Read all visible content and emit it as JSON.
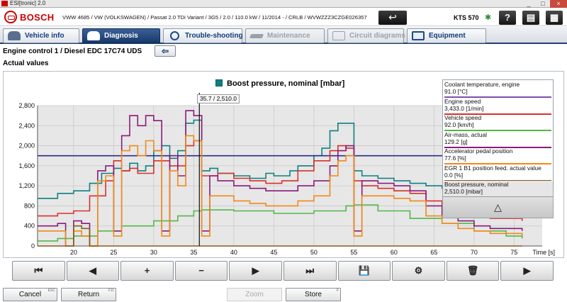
{
  "window": {
    "title": "ESI[tronic] 2.0",
    "minimize": "_",
    "maximize": "□",
    "close": "×"
  },
  "header": {
    "brand": "BOSCH",
    "vehicle": "VWW 4685 / VW (VOLKSWAGEN) / Passat 2.0 TDi Variant / 3G5 / 2.0 / 110.0 kW / 11/2014 - / CRLB / WVWZZZ3CZGE026357",
    "back_icon": "↩",
    "device": "KTS 570",
    "bluetooth_icon": "✱",
    "help_icon": "?",
    "print_icon": "▤",
    "menu_icon": "▦"
  },
  "tabs": [
    {
      "label": "Vehicle info",
      "state": "normal"
    },
    {
      "label": "Diagnosis",
      "state": "active"
    },
    {
      "label": "Trouble-shooting",
      "state": "normal"
    },
    {
      "label": "Maintenance",
      "state": "disabled"
    },
    {
      "label": "Circuit diagrams",
      "state": "disabled"
    },
    {
      "label": "Equipment",
      "state": "normal"
    }
  ],
  "ecu": {
    "title": "Engine control 1 / Diesel EDC 17C74 UDS",
    "back_icon": "⇦"
  },
  "subtitle": "Actual values",
  "cursor_readout": "35.7 / 2,510.0",
  "legend": [
    {
      "name": "Coolant temperature, engine",
      "value": "91.0 [°C]",
      "color": "#7f4fa8"
    },
    {
      "name": "Engine speed",
      "value": "3,433.0 [1/min]",
      "color": "#d9302a"
    },
    {
      "name": "Vehicle speed",
      "value": "92.0 [km/h]",
      "color": "#52b848"
    },
    {
      "name": "Air-mass, actual",
      "value": "129.2 [g]",
      "color": "#8a1a7a"
    },
    {
      "name": "Accelerator pedal position",
      "value": "77.6 [%]",
      "color": "#f08a18"
    },
    {
      "name": "EGR 1 B1 position feed. actual value",
      "value": "0.0 [%]",
      "color": "#8a5a1a"
    },
    {
      "name": "Boost pressure, nominal",
      "value": "2,510.0 [mbar]",
      "color": "#0f8080"
    }
  ],
  "legend_scroll_icon": "△",
  "toolbar": [
    {
      "icon": "first-icon",
      "glyph": "⏮"
    },
    {
      "icon": "prev-icon",
      "glyph": "◀"
    },
    {
      "icon": "zoom-in-icon",
      "glyph": "+"
    },
    {
      "icon": "zoom-out-icon",
      "glyph": "−"
    },
    {
      "icon": "next-icon",
      "glyph": "▶"
    },
    {
      "icon": "last-icon",
      "glyph": "⏭"
    },
    {
      "icon": "save-icon",
      "glyph": "💾"
    },
    {
      "icon": "chart-settings-icon",
      "glyph": "⚙"
    },
    {
      "icon": "delete-icon",
      "glyph": "🗑"
    },
    {
      "icon": "play-icon",
      "glyph": "▶"
    }
  ],
  "bottom": {
    "cancel": "Cancel",
    "cancel_key": "ESC",
    "return": "Return",
    "return_key": "F11",
    "zoom": "Zoom",
    "store": "Store",
    "store_key": "F"
  },
  "chart_data": {
    "type": "line",
    "title": "Boost pressure, nominal [mbar]",
    "xlabel": "Time [s]",
    "ylabel": "",
    "xlim": [
      15.5,
      78.5
    ],
    "ylim": [
      0,
      2800
    ],
    "xticks": [
      20,
      25,
      30,
      35,
      40,
      45,
      50,
      55,
      60,
      65,
      70,
      75
    ],
    "yticks": [
      0,
      400,
      800,
      1200,
      1600,
      2000,
      2400,
      2800
    ],
    "grid": true,
    "cursor_x": 35.7,
    "series": [
      {
        "name": "Boost pressure, nominal",
        "color": "#0f8080",
        "x": [
          15.5,
          18,
          20,
          22,
          23.5,
          25,
          26,
          27,
          28,
          29,
          30,
          31,
          32,
          33,
          34,
          35,
          36,
          37,
          38,
          40,
          42,
          44,
          45,
          47,
          48,
          50,
          51,
          52,
          53,
          54,
          55,
          56,
          58,
          60,
          62,
          64,
          66,
          68,
          70,
          72,
          76
        ],
        "y": [
          950,
          1050,
          1100,
          1250,
          1450,
          1550,
          1500,
          1650,
          1500,
          1600,
          1900,
          2000,
          1750,
          1900,
          2450,
          2510,
          1500,
          1550,
          1450,
          1400,
          1350,
          1450,
          1400,
          1500,
          1600,
          1800,
          1950,
          2300,
          2450,
          2450,
          1500,
          1400,
          1350,
          1300,
          1250,
          1200,
          1150,
          1150,
          1100,
          1100,
          1050
        ]
      },
      {
        "name": "Coolant temperature, engine",
        "color": "#2a2a8a",
        "x": [
          15.5,
          78.5
        ],
        "y": [
          1800,
          1800
        ]
      },
      {
        "name": "Engine speed",
        "color": "#d9302a",
        "x": [
          15.5,
          18,
          20,
          22,
          24,
          25,
          26,
          27,
          28,
          30,
          32,
          34,
          35,
          36,
          38,
          40,
          42,
          44,
          46,
          48,
          50,
          52,
          53,
          54,
          55,
          56,
          58,
          60,
          62,
          64,
          66,
          68,
          70,
          72,
          76
        ],
        "y": [
          600,
          650,
          700,
          1000,
          1300,
          1700,
          1500,
          1550,
          1450,
          1700,
          1600,
          2000,
          2100,
          1400,
          1450,
          1350,
          1300,
          1250,
          1300,
          1500,
          1700,
          1900,
          2000,
          1950,
          1300,
          1200,
          1150,
          1100,
          1050,
          900,
          800,
          700,
          600,
          550,
          500
        ]
      },
      {
        "name": "Vehicle speed",
        "color": "#52b848",
        "x": [
          15.5,
          18,
          20,
          23,
          26,
          30,
          33,
          35,
          36,
          40,
          45,
          50,
          54,
          55,
          58,
          62,
          66,
          70,
          74,
          76
        ],
        "y": [
          100,
          150,
          200,
          300,
          400,
          500,
          600,
          700,
          720,
          700,
          650,
          700,
          800,
          820,
          700,
          550,
          450,
          300,
          200,
          150
        ]
      },
      {
        "name": "Air-mass, actual",
        "color": "#8a1a7a",
        "x": [
          15.5,
          18,
          19,
          20,
          21,
          22,
          23,
          24,
          25,
          26,
          27,
          28,
          29,
          30,
          31,
          32,
          33,
          34,
          35,
          36,
          37,
          38,
          40,
          42,
          44,
          46,
          48,
          50,
          52,
          53,
          54,
          55,
          56,
          58,
          60,
          62,
          64,
          66,
          68,
          70,
          72,
          76
        ],
        "y": [
          400,
          450,
          0,
          500,
          450,
          0,
          1500,
          1600,
          300,
          2200,
          2600,
          2400,
          2600,
          2500,
          300,
          1800,
          1400,
          2700,
          2600,
          300,
          1400,
          1300,
          1200,
          1150,
          1100,
          1100,
          1200,
          1300,
          1600,
          1900,
          2000,
          300,
          1300,
          1250,
          1200,
          1100,
          800,
          600,
          500,
          400,
          350,
          300
        ]
      },
      {
        "name": "Accelerator pedal position",
        "color": "#f08a18",
        "x": [
          15.5,
          18,
          19,
          20,
          21,
          22,
          23,
          24,
          25,
          26,
          27,
          28,
          29,
          30,
          31,
          32,
          33,
          34,
          35,
          36,
          37,
          38,
          40,
          42,
          44,
          46,
          48,
          50,
          52,
          53,
          54,
          55,
          56,
          58,
          60,
          62,
          64,
          66,
          68,
          70,
          72,
          76
        ],
        "y": [
          300,
          300,
          0,
          300,
          200,
          0,
          1300,
          1400,
          200,
          1900,
          2000,
          1800,
          2100,
          1900,
          200,
          1500,
          1200,
          2200,
          2100,
          200,
          1000,
          1000,
          900,
          850,
          800,
          800,
          900,
          1000,
          1400,
          1700,
          1800,
          200,
          1000,
          1000,
          950,
          900,
          600,
          450,
          350,
          300,
          250,
          200
        ]
      },
      {
        "name": "EGR 1 B1 position feed. actual value",
        "color": "#8a5a1a",
        "x": [
          15.5,
          19,
          20,
          21,
          22,
          23,
          24,
          25,
          26,
          28,
          30,
          32,
          34,
          36,
          38,
          40,
          45,
          50,
          53,
          54,
          55,
          56,
          58,
          62,
          66,
          70,
          76
        ],
        "y": [
          0,
          0,
          400,
          350,
          0,
          0,
          0,
          0,
          0,
          0,
          0,
          0,
          0,
          0,
          0,
          0,
          0,
          0,
          0,
          0,
          0,
          0,
          0,
          0,
          0,
          0,
          0
        ]
      }
    ]
  }
}
